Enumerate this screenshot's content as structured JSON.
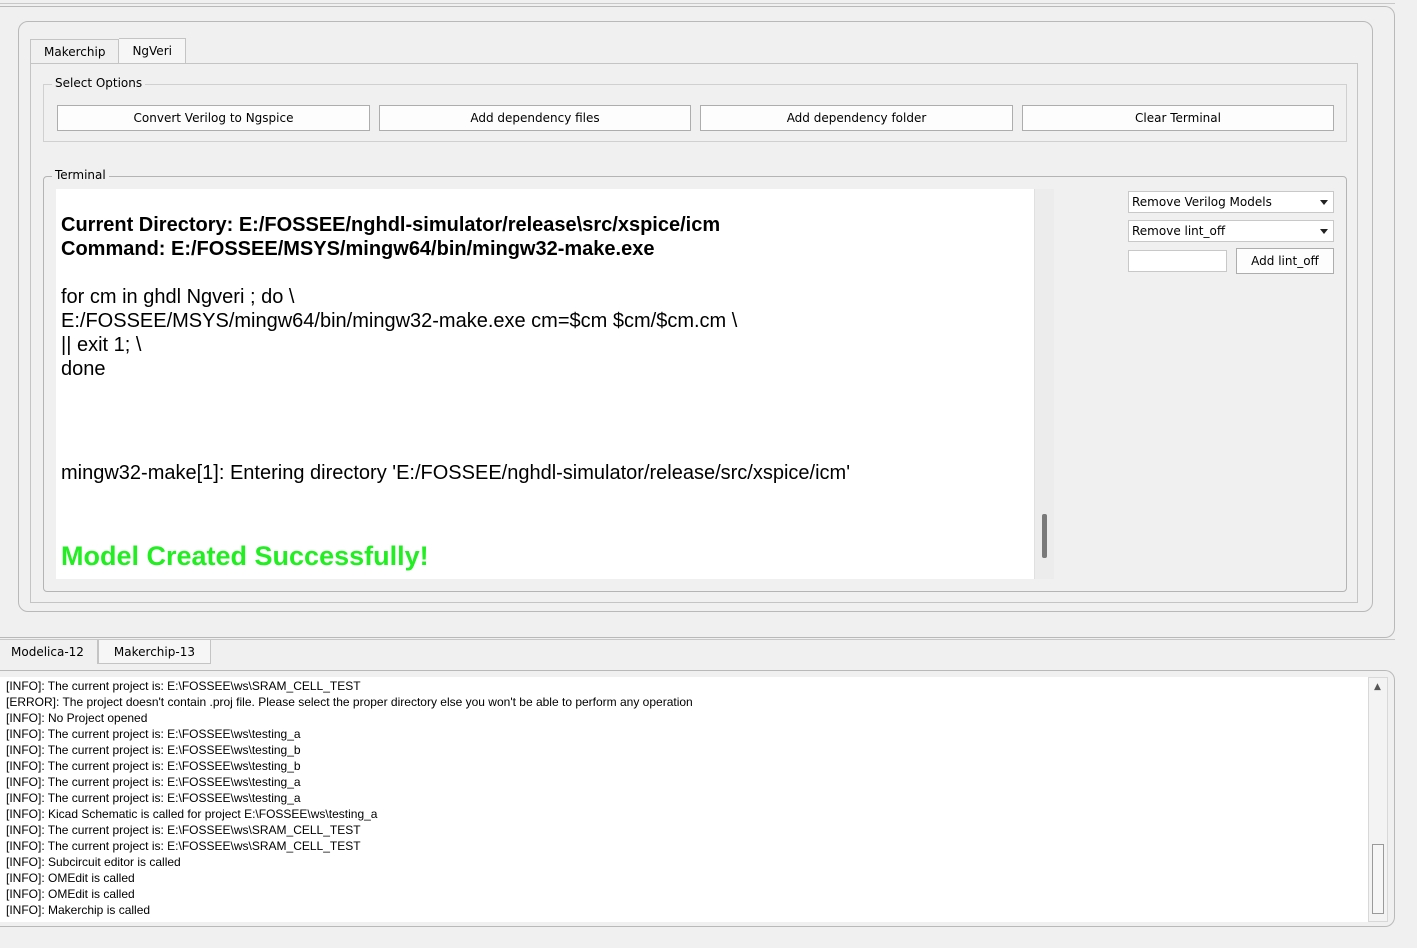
{
  "tabs": [
    {
      "label": "Makerchip"
    },
    {
      "label": "NgVeri"
    }
  ],
  "options": {
    "title": "Select Options",
    "buttons": [
      {
        "label": "Convert Verilog to Ngspice"
      },
      {
        "label": "Add dependency files"
      },
      {
        "label": "Add dependency folder"
      },
      {
        "label": "Clear Terminal"
      }
    ]
  },
  "terminal": {
    "title": "Terminal",
    "lines": [
      "Current Directory: E:/FOSSEE/nghdl-simulator/release\\src/xspice/icm",
      "Command: E:/FOSSEE/MSYS/mingw64/bin/mingw32-make.exe",
      "for cm in ghdl Ngveri ; do \\",
      "E:/FOSSEE/MSYS/mingw64/bin/mingw32-make.exe cm=$cm $cm/$cm.cm \\",
      "|| exit 1; \\",
      "done",
      "mingw32-make[1]: Entering directory 'E:/FOSSEE/nghdl-simulator/release/src/xspice/icm'",
      "Model Created Successfully!"
    ],
    "success_color": "#22ee22"
  },
  "side": {
    "remove_models": "Remove Verilog Models",
    "remove_lint": "Remove lint_off",
    "lint_value": "",
    "add_lint": "Add lint_off"
  },
  "bottom_tabs": [
    {
      "label": "Modelica-12"
    },
    {
      "label": "Makerchip-13"
    }
  ],
  "log": [
    "[INFO]: The current project is: E:\\FOSSEE\\ws\\SRAM_CELL_TEST",
    "[ERROR]: The project doesn't contain .proj file. Please select the proper directory else you won't be able to perform any operation",
    "[INFO]: No Project opened",
    "[INFO]: The current project is: E:\\FOSSEE\\ws\\testing_a",
    "[INFO]: The current project is: E:\\FOSSEE\\ws\\testing_b",
    "[INFO]: The current project is: E:\\FOSSEE\\ws\\testing_b",
    "[INFO]: The current project is: E:\\FOSSEE\\ws\\testing_a",
    "[INFO]: The current project is: E:\\FOSSEE\\ws\\testing_a",
    "[INFO]: Kicad Schematic is called for project E:\\FOSSEE\\ws\\testing_a",
    "[INFO]: The current project is: E:\\FOSSEE\\ws\\SRAM_CELL_TEST",
    "[INFO]: The current project is: E:\\FOSSEE\\ws\\SRAM_CELL_TEST",
    "[INFO]: Subcircuit editor is called",
    "[INFO]: OMEdit is called",
    "[INFO]: OMEdit is called",
    "[INFO]: Makerchip is called"
  ]
}
